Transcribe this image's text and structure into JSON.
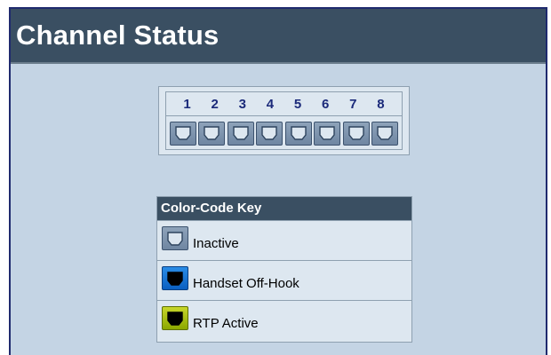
{
  "page": {
    "title": "Channel Status"
  },
  "channels": {
    "numbers": [
      "1",
      "2",
      "3",
      "4",
      "5",
      "6",
      "7",
      "8"
    ],
    "states": [
      "inactive",
      "inactive",
      "inactive",
      "inactive",
      "inactive",
      "inactive",
      "inactive",
      "inactive"
    ]
  },
  "key": {
    "header": "Color-Code Key",
    "items": [
      {
        "label": "Inactive",
        "state": "inactive",
        "color": "#7890ab"
      },
      {
        "label": "Handset Off-Hook",
        "state": "offhook",
        "color": "#1a76d6"
      },
      {
        "label": "RTP Active",
        "state": "rtp",
        "color": "#a8c010"
      }
    ]
  },
  "colors": {
    "title_bar": "#3a4f62",
    "background": "#c4d4e4",
    "channel_number": "#1b2a7a"
  }
}
